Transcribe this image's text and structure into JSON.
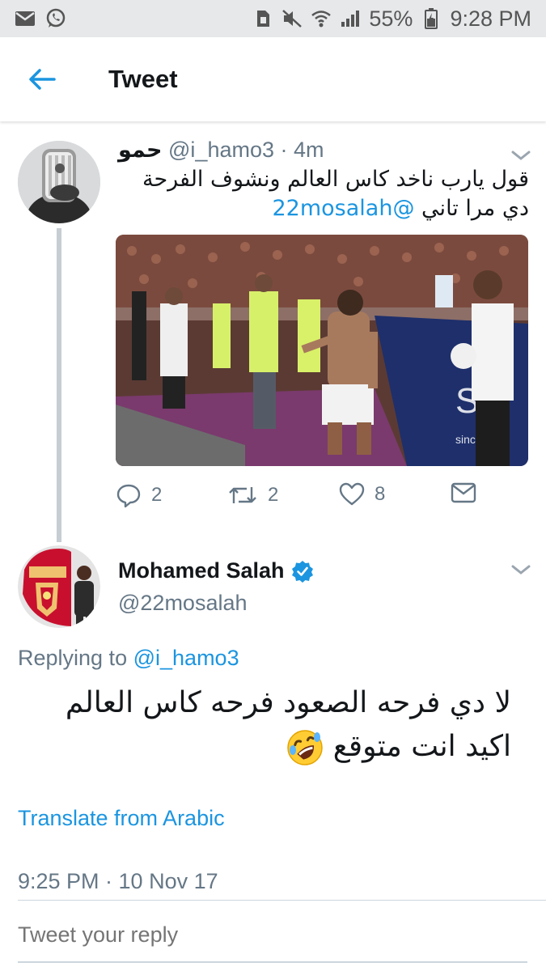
{
  "status_bar": {
    "battery_percent": "55%",
    "time": "9:28 PM",
    "icons": [
      "mail-icon",
      "whatsapp-icon",
      "sim-icon",
      "mute-icon",
      "wifi-icon",
      "signal-icon",
      "battery-icon"
    ]
  },
  "header": {
    "title": "Tweet",
    "back_icon": "back-arrow-icon"
  },
  "parent_tweet": {
    "name": "حمو",
    "handle": "@i_hamo3",
    "time": "· 4m",
    "text": "قول يارب ناخد كاس العالم ونشوف الفرحة دي مرا تاني",
    "mention": "@22mosalah",
    "actions": {
      "reply_count": "2",
      "retweet_count": "2",
      "like_count": "8"
    }
  },
  "main_tweet": {
    "name": "Mohamed Salah",
    "verified": true,
    "handle": "@22mosalah",
    "replying_prefix": "Replying to",
    "replying_to": "@i_hamo3",
    "text": "لا دي فرحه الصعود فرحه كاس العالم اكيد انت متوقع",
    "emoji": "rolling-on-floor-laughing-emoji",
    "translate_label": "Translate from Arabic",
    "timestamp": "9:25 PM · 10 Nov 17"
  },
  "reply_box": {
    "placeholder": "Tweet your reply"
  },
  "colors": {
    "accent": "#1b95e0",
    "secondary_text": "#657786",
    "status_bar_bg": "#e6e8ea"
  }
}
